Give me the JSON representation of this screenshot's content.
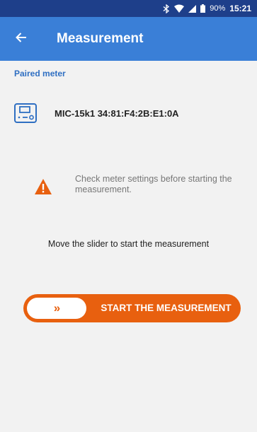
{
  "status_bar": {
    "battery_percent": "90%",
    "time": "15:21",
    "icons": [
      "bluetooth-icon",
      "wifi-icon",
      "signal-icon",
      "battery-icon"
    ]
  },
  "app_bar": {
    "back_icon": "arrow-back-icon",
    "title": "Measurement"
  },
  "paired_meter": {
    "section_label": "Paired meter",
    "icon": "meter-device-icon",
    "name": "MIC-15k1 34:81:F4:2B:E1:0A"
  },
  "warning": {
    "icon": "warning-triangle-icon",
    "text": "Check meter settings before starting the measurement."
  },
  "instruction": "Move the slider to start the measurement",
  "slider": {
    "knob_symbol": "»",
    "label": "START THE MEASUREMENT",
    "position": 0
  },
  "colors": {
    "status_bar": "#1e3f8a",
    "app_bar": "#3a7fd7",
    "accent_orange": "#e8600f",
    "section_blue": "#2f6fc2",
    "background": "#f2f2f2"
  }
}
